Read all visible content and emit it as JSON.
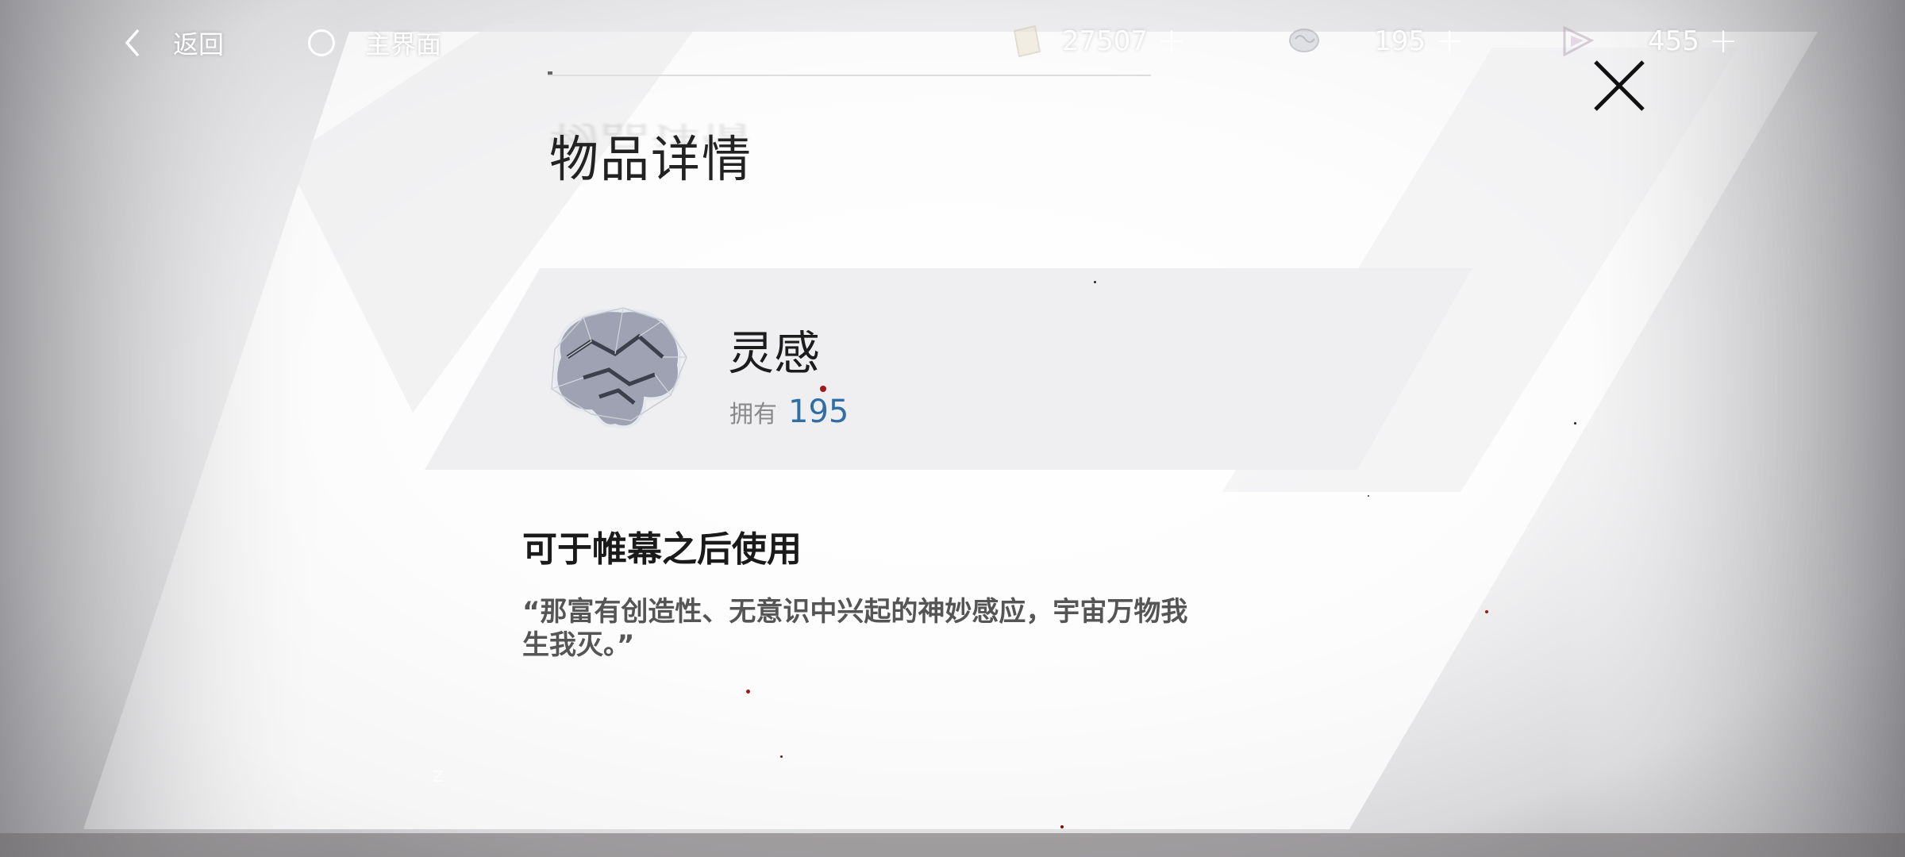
{
  "nav": {
    "back_label": "返回",
    "home_label": "主界面"
  },
  "currencies": [
    {
      "icon": "paper-currency-icon",
      "amount": "27507",
      "plus": "+"
    },
    {
      "icon": "brain-currency-icon",
      "amount": "195",
      "plus": "+"
    },
    {
      "icon": "crystal-currency-icon",
      "amount": "455",
      "plus": "+"
    }
  ],
  "close_icon": "close-icon",
  "page": {
    "title": "物品详情"
  },
  "item": {
    "icon": "brain-icon",
    "name": "灵感",
    "own_label": "拥有",
    "own_value": "195"
  },
  "usage": "可于帷幕之后使用",
  "description_line1": "“那富有创造性、无意识中兴起的神妙感应，宇宙万物我",
  "description_line2": "生我灭。”",
  "colors": {
    "accent_blue": "#2f6fa6",
    "title_text": "#222222",
    "card_bg": "#efeff1"
  },
  "decor_mark": "z"
}
